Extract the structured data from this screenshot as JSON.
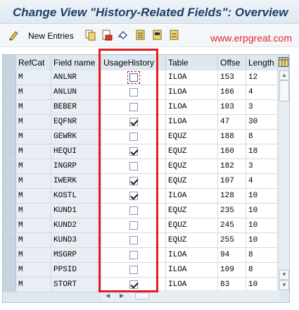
{
  "window": {
    "title": "Change View \"History-Related Fields\": Overview"
  },
  "toolbar": {
    "new_entries_label": "New Entries",
    "icons": [
      "pencil-glasses-icon",
      "copy-icon",
      "delete-icon",
      "undo-icon",
      "select-all-icon",
      "select-block-icon",
      "deselect-all-icon"
    ]
  },
  "watermark": "www.erpgreat.com",
  "table": {
    "headers": {
      "refcat": "RefCat",
      "field": "Field name",
      "usage": "UsageHistory",
      "table": "Table",
      "offset": "Offse",
      "length": "Length"
    },
    "rows": [
      {
        "refcat": "M",
        "field": "ANLNR",
        "usage": false,
        "table": "ILOA",
        "offset": "153",
        "length": "12"
      },
      {
        "refcat": "M",
        "field": "ANLUN",
        "usage": false,
        "table": "ILOA",
        "offset": "166",
        "length": "4"
      },
      {
        "refcat": "M",
        "field": "BEBER",
        "usage": false,
        "table": "ILOA",
        "offset": "103",
        "length": "3"
      },
      {
        "refcat": "M",
        "field": "EQFNR",
        "usage": true,
        "table": "ILOA",
        "offset": "47",
        "length": "30"
      },
      {
        "refcat": "M",
        "field": "GEWRK",
        "usage": false,
        "table": "EQUZ",
        "offset": "188",
        "length": "8"
      },
      {
        "refcat": "M",
        "field": "HEQUI",
        "usage": true,
        "table": "EQUZ",
        "offset": "160",
        "length": "18"
      },
      {
        "refcat": "M",
        "field": "INGRP",
        "usage": false,
        "table": "EQUZ",
        "offset": "182",
        "length": "3"
      },
      {
        "refcat": "M",
        "field": "IWERK",
        "usage": true,
        "table": "EQUZ",
        "offset": "107",
        "length": "4"
      },
      {
        "refcat": "M",
        "field": "KOSTL",
        "usage": true,
        "table": "ILOA",
        "offset": "128",
        "length": "10"
      },
      {
        "refcat": "M",
        "field": "KUND1",
        "usage": false,
        "table": "EQUZ",
        "offset": "235",
        "length": "10"
      },
      {
        "refcat": "M",
        "field": "KUND2",
        "usage": false,
        "table": "EQUZ",
        "offset": "245",
        "length": "10"
      },
      {
        "refcat": "M",
        "field": "KUND3",
        "usage": false,
        "table": "EQUZ",
        "offset": "255",
        "length": "10"
      },
      {
        "refcat": "M",
        "field": "MSGRP",
        "usage": false,
        "table": "ILOA",
        "offset": "94",
        "length": "8"
      },
      {
        "refcat": "M",
        "field": "PPSID",
        "usage": false,
        "table": "ILOA",
        "offset": "109",
        "length": "8"
      },
      {
        "refcat": "M",
        "field": "STORT",
        "usage": true,
        "table": "ILOA",
        "offset": "83",
        "length": "10"
      }
    ]
  },
  "colors": {
    "highlight": "#e41d23",
    "title": "#1f3f66",
    "watermark": "#e2262b"
  }
}
